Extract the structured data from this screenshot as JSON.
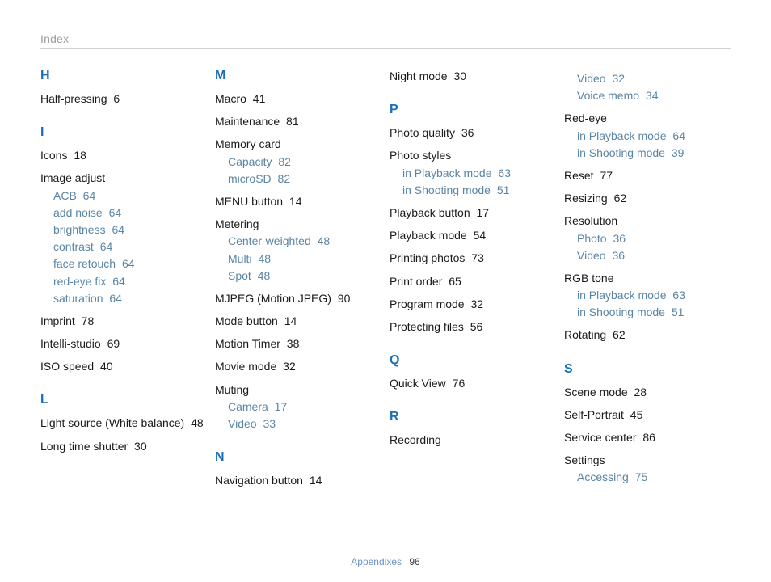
{
  "header": "Index",
  "footer": {
    "label": "Appendixes",
    "page": "96"
  },
  "columns": [
    {
      "sections": [
        {
          "letter": "H",
          "entries": [
            {
              "label": "Half-pressing",
              "page": "6"
            }
          ]
        },
        {
          "letter": "I",
          "entries": [
            {
              "label": "Icons",
              "page": "18"
            },
            {
              "label": "Image adjust",
              "page": "",
              "subs": [
                {
                  "label": "ACB",
                  "page": "64"
                },
                {
                  "label": "add noise",
                  "page": "64"
                },
                {
                  "label": "brightness",
                  "page": "64"
                },
                {
                  "label": "contrast",
                  "page": "64"
                },
                {
                  "label": "face retouch",
                  "page": "64"
                },
                {
                  "label": "red-eye fix",
                  "page": "64"
                },
                {
                  "label": "saturation",
                  "page": "64"
                }
              ]
            },
            {
              "label": "Imprint",
              "page": "78"
            },
            {
              "label": "Intelli-studio",
              "page": "69"
            },
            {
              "label": "ISO speed",
              "page": "40"
            }
          ]
        },
        {
          "letter": "L",
          "entries": [
            {
              "label": "Light source (White balance)",
              "page": "48"
            },
            {
              "label": "Long time shutter",
              "page": "30"
            }
          ]
        }
      ]
    },
    {
      "sections": [
        {
          "letter": "M",
          "entries": [
            {
              "label": "Macro",
              "page": "41"
            },
            {
              "label": "Maintenance",
              "page": "81"
            },
            {
              "label": "Memory card",
              "page": "",
              "subs": [
                {
                  "label": "Capacity",
                  "page": "82"
                },
                {
                  "label": "microSD",
                  "page": "82"
                }
              ]
            },
            {
              "label": "MENU button",
              "page": "14"
            },
            {
              "label": "Metering",
              "page": "",
              "subs": [
                {
                  "label": "Center-weighted",
                  "page": "48"
                },
                {
                  "label": "Multi",
                  "page": "48"
                },
                {
                  "label": "Spot",
                  "page": "48"
                }
              ]
            },
            {
              "label": "MJPEG (Motion JPEG)",
              "page": "90"
            },
            {
              "label": "Mode button",
              "page": "14"
            },
            {
              "label": "Motion Timer",
              "page": "38"
            },
            {
              "label": "Movie mode",
              "page": "32"
            },
            {
              "label": "Muting",
              "page": "",
              "subs": [
                {
                  "label": "Camera",
                  "page": "17"
                },
                {
                  "label": "Video",
                  "page": "33"
                }
              ]
            }
          ]
        },
        {
          "letter": "N",
          "entries": [
            {
              "label": "Navigation button",
              "page": "14"
            }
          ]
        }
      ]
    },
    {
      "sections": [
        {
          "letter": "",
          "entries": [
            {
              "label": "Night mode",
              "page": "30"
            }
          ]
        },
        {
          "letter": "P",
          "entries": [
            {
              "label": "Photo quality",
              "page": "36"
            },
            {
              "label": "Photo styles",
              "page": "",
              "subs": [
                {
                  "label": "in Playback mode",
                  "page": "63"
                },
                {
                  "label": "in Shooting mode",
                  "page": "51"
                }
              ]
            },
            {
              "label": "Playback button",
              "page": "17"
            },
            {
              "label": "Playback mode",
              "page": "54"
            },
            {
              "label": "Printing photos",
              "page": "73"
            },
            {
              "label": "Print order",
              "page": "65"
            },
            {
              "label": "Program mode",
              "page": "32"
            },
            {
              "label": "Protecting files",
              "page": "56"
            }
          ]
        },
        {
          "letter": "Q",
          "entries": [
            {
              "label": "Quick View",
              "page": "76"
            }
          ]
        },
        {
          "letter": "R",
          "entries": [
            {
              "label": "Recording",
              "page": ""
            }
          ]
        }
      ]
    },
    {
      "sections": [
        {
          "letter": "",
          "entries": [
            {
              "label": "",
              "page": "",
              "subs": [
                {
                  "label": "Video",
                  "page": "32"
                },
                {
                  "label": "Voice memo",
                  "page": "34"
                }
              ]
            },
            {
              "label": "Red-eye",
              "page": "",
              "subs": [
                {
                  "label": "in Playback mode",
                  "page": "64"
                },
                {
                  "label": "in Shooting mode",
                  "page": "39"
                }
              ]
            },
            {
              "label": "Reset",
              "page": "77"
            },
            {
              "label": "Resizing",
              "page": "62"
            },
            {
              "label": "Resolution",
              "page": "",
              "subs": [
                {
                  "label": "Photo",
                  "page": "36"
                },
                {
                  "label": "Video",
                  "page": "36"
                }
              ]
            },
            {
              "label": "RGB tone",
              "page": "",
              "subs": [
                {
                  "label": "in Playback mode",
                  "page": "63"
                },
                {
                  "label": "in Shooting mode",
                  "page": "51"
                }
              ]
            },
            {
              "label": "Rotating",
              "page": "62"
            }
          ]
        },
        {
          "letter": "S",
          "entries": [
            {
              "label": "Scene mode",
              "page": "28"
            },
            {
              "label": "Self-Portrait",
              "page": "45"
            },
            {
              "label": "Service center",
              "page": "86"
            },
            {
              "label": "Settings",
              "page": "",
              "subs": [
                {
                  "label": "Accessing",
                  "page": "75"
                }
              ]
            }
          ]
        }
      ]
    }
  ]
}
